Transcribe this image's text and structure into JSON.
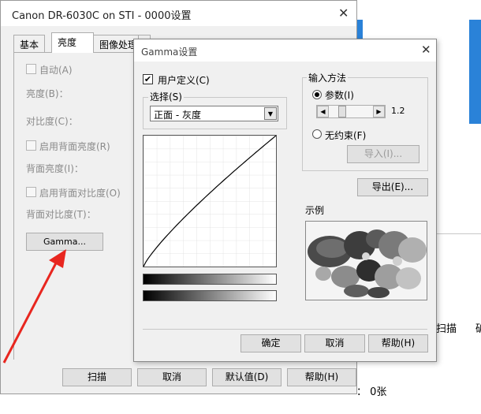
{
  "main_window": {
    "title": "Canon DR-6030C on STI - 0000设置",
    "close": "✕",
    "tabs": [
      "基本",
      "亮度",
      "图像处理",
      ""
    ],
    "auto_label": "自动(A)",
    "brightness_label": "亮度(B)：",
    "contrast_label": "对比度(C)：",
    "enable_back_brightness": "启用背面亮度(R)",
    "back_brightness_label": "背面亮度(I)：",
    "enable_back_contrast": "启用背面对比度(O)",
    "back_contrast_label": "背面对比度(T)：",
    "gamma_button": "Gamma...",
    "scan_button": "扫描",
    "cancel_button": "取消",
    "default_button": "默认值(D)",
    "help_button": "帮助(H)"
  },
  "gamma_dialog": {
    "title": "Gamma设置",
    "close": "✕",
    "user_defined_label": "用户定义(C)",
    "user_defined_checked": true,
    "select_group_label": "选择(S)",
    "select_value": "正面 - 灰度",
    "input_method_label": "输入方法",
    "param_label": "参数(I)",
    "param_value": "1.2",
    "unconstrained_label": "无约束(F)",
    "import_button": "导入(I)...",
    "export_button": "导出(E)...",
    "sample_label": "示例",
    "ok_button": "确定",
    "cancel_button": "取消",
    "help_button": "帮助(H)"
  },
  "background": {
    "scan_text": "扫描",
    "partial_char": "矿",
    "count_text": "：  0张"
  },
  "colors": {
    "accent_blue": "#2a82d8",
    "arrow_red": "#e8261f"
  },
  "icons": {
    "checkbox_checked": "check-icon",
    "dropdown": "chevron-down-icon",
    "slider_left": "arrow-left-icon",
    "slider_right": "arrow-right-icon"
  }
}
